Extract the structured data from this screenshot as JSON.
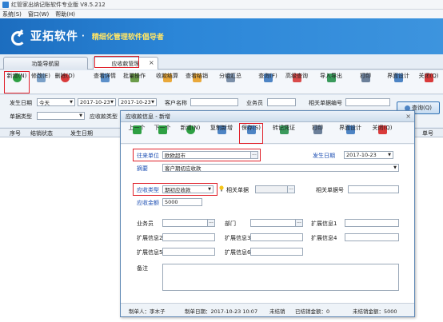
{
  "window": {
    "title": "红管家出纳记账软件专业版 V8.5.212"
  },
  "menu": {
    "items": [
      "系统(S)",
      "窗口(W)",
      "帮助(H)"
    ]
  },
  "banner": {
    "logo_text": "亚拓软件",
    "dot": "·",
    "slogan": "精细化管理软件倡导者"
  },
  "tabs": [
    {
      "label": "功能导航窗"
    },
    {
      "label": "应收款管理"
    }
  ],
  "tab_close": "×",
  "toolbar": {
    "buttons": [
      {
        "label": "新增(N)",
        "icon": "add-icon",
        "color": "#2ea043"
      },
      {
        "label": "修改(E)",
        "icon": "edit-icon",
        "color": "#7aa0c8"
      },
      {
        "label": "删除(D)",
        "icon": "delete-icon",
        "color": "#d93a3a"
      },
      {
        "label": "查看详情",
        "icon": "detail-icon",
        "color": "#5b8fc9"
      },
      {
        "label": "批量操作",
        "icon": "batch-icon",
        "color": "#6b9c4a"
      },
      {
        "label": "收款结算",
        "icon": "receipt-icon",
        "color": "#e9a83a"
      },
      {
        "label": "查看结销",
        "icon": "settle-icon",
        "color": "#e9a83a"
      },
      {
        "label": "分组汇总",
        "icon": "group-icon",
        "color": "#7b8fa8"
      },
      {
        "label": "查询(F)",
        "icon": "query-icon",
        "color": "#4d84c4"
      },
      {
        "label": "高级查询",
        "icon": "advanced-query-icon",
        "color": "#d94a4a"
      },
      {
        "label": "导入导出",
        "icon": "import-export-icon",
        "color": "#3a9a5c"
      },
      {
        "label": "打印",
        "icon": "print-icon",
        "color": "#6b7f99"
      },
      {
        "label": "界面设计",
        "icon": "design-icon",
        "color": "#4d84c4"
      },
      {
        "label": "关闭(Q)",
        "icon": "close-icon",
        "color": "#d93a3a"
      }
    ]
  },
  "filters": {
    "date_label": "发生日期",
    "date_preset": "今天",
    "date_from": "2017-10-23",
    "date_to": "2017-10-23",
    "customer_label": "客户名称",
    "salesperson_label": "业务员",
    "related_no_label": "相关单据编号",
    "doc_type_label": "单据类型",
    "recv_type_label": "应收款类型",
    "query_button": "查询(Q)"
  },
  "grid": {
    "columns": [
      "序号",
      "结销状态",
      "发生日期",
      "",
      "单号"
    ]
  },
  "dialog": {
    "title": "应收款信息 - 新增",
    "close": "×",
    "toolbar": [
      {
        "label": "上一个",
        "icon": "prev-icon",
        "color": "#2ea043"
      },
      {
        "label": "下一个",
        "icon": "next-icon",
        "color": "#2ea043"
      },
      {
        "label": "新增(N)",
        "icon": "add-icon",
        "color": "#2ea043"
      },
      {
        "label": "复制新增",
        "icon": "copy-add-icon",
        "color": "#4d84c4"
      },
      {
        "label": "保存(S)",
        "icon": "save-icon",
        "color": "#4d84c4"
      },
      {
        "label": "转记凭证",
        "icon": "voucher-icon",
        "color": "#3a9a5c"
      },
      {
        "label": "打印",
        "icon": "print-icon",
        "color": "#6b7f99"
      },
      {
        "label": "界面设计",
        "icon": "design-icon",
        "color": "#4d84c4"
      },
      {
        "label": "关闭(Q)",
        "icon": "close-icon",
        "color": "#d93a3a"
      }
    ],
    "form": {
      "unit_label": "往来单位",
      "unit_value": "欧欧超市",
      "date_label": "发生日期",
      "date_value": "2017-10-23",
      "summary_label": "摘要",
      "summary_value": "客户期初应收款",
      "recv_type_label": "应收类型",
      "recv_type_value": "期初应收款",
      "related_doc_label": "相关单据",
      "related_no_label": "相关单据号",
      "amount_label": "应收金额",
      "amount_value": "5000",
      "salesperson_label": "业务员",
      "dept_label": "部门",
      "ext1_label": "扩展信息1",
      "ext2_label": "扩展信息2",
      "ext3_label": "扩展信息3",
      "ext4_label": "扩展信息4",
      "ext5_label": "扩展信息5",
      "ext6_label": "扩展信息6",
      "note_label": "备注"
    },
    "status": {
      "creator": "制单人：李木子",
      "created": "制单日期：2017-10-23 10:07",
      "state": "未结销",
      "settled": "已结销金额：0",
      "unsettled": "未结销金额：5000"
    }
  },
  "ellipsis": "···",
  "dropdown_arrow": "▼",
  "colors": {
    "banner": "#2b86d8",
    "highlight": "#e0202a",
    "label_blue": "#1d4fb3"
  }
}
